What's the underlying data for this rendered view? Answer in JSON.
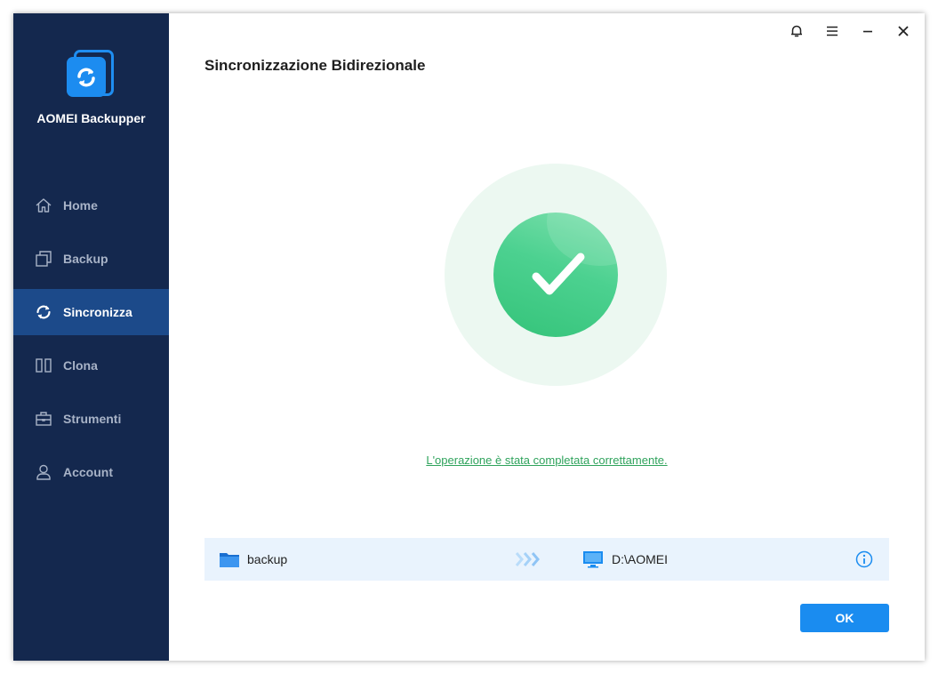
{
  "app": {
    "name": "AOMEI Backupper"
  },
  "sidebar": {
    "items": [
      {
        "label": "Home",
        "icon": "home-icon"
      },
      {
        "label": "Backup",
        "icon": "backup-icon"
      },
      {
        "label": "Sincronizza",
        "icon": "sync-icon",
        "active": true
      },
      {
        "label": "Clona",
        "icon": "clone-icon"
      },
      {
        "label": "Strumenti",
        "icon": "toolbox-icon"
      },
      {
        "label": "Account",
        "icon": "user-icon"
      }
    ]
  },
  "header": {
    "title": "Sincronizzazione Bidirezionale"
  },
  "result": {
    "message": "L'operazione è stata completata correttamente.",
    "status_color": "#34c379"
  },
  "task": {
    "source": "backup",
    "destination": "D:\\AOMEI"
  },
  "footer": {
    "ok_label": "OK"
  },
  "colors": {
    "sidebar_bg": "#14284e",
    "active_item_bg": "#1c4a8a",
    "accent": "#1a8cf0"
  }
}
